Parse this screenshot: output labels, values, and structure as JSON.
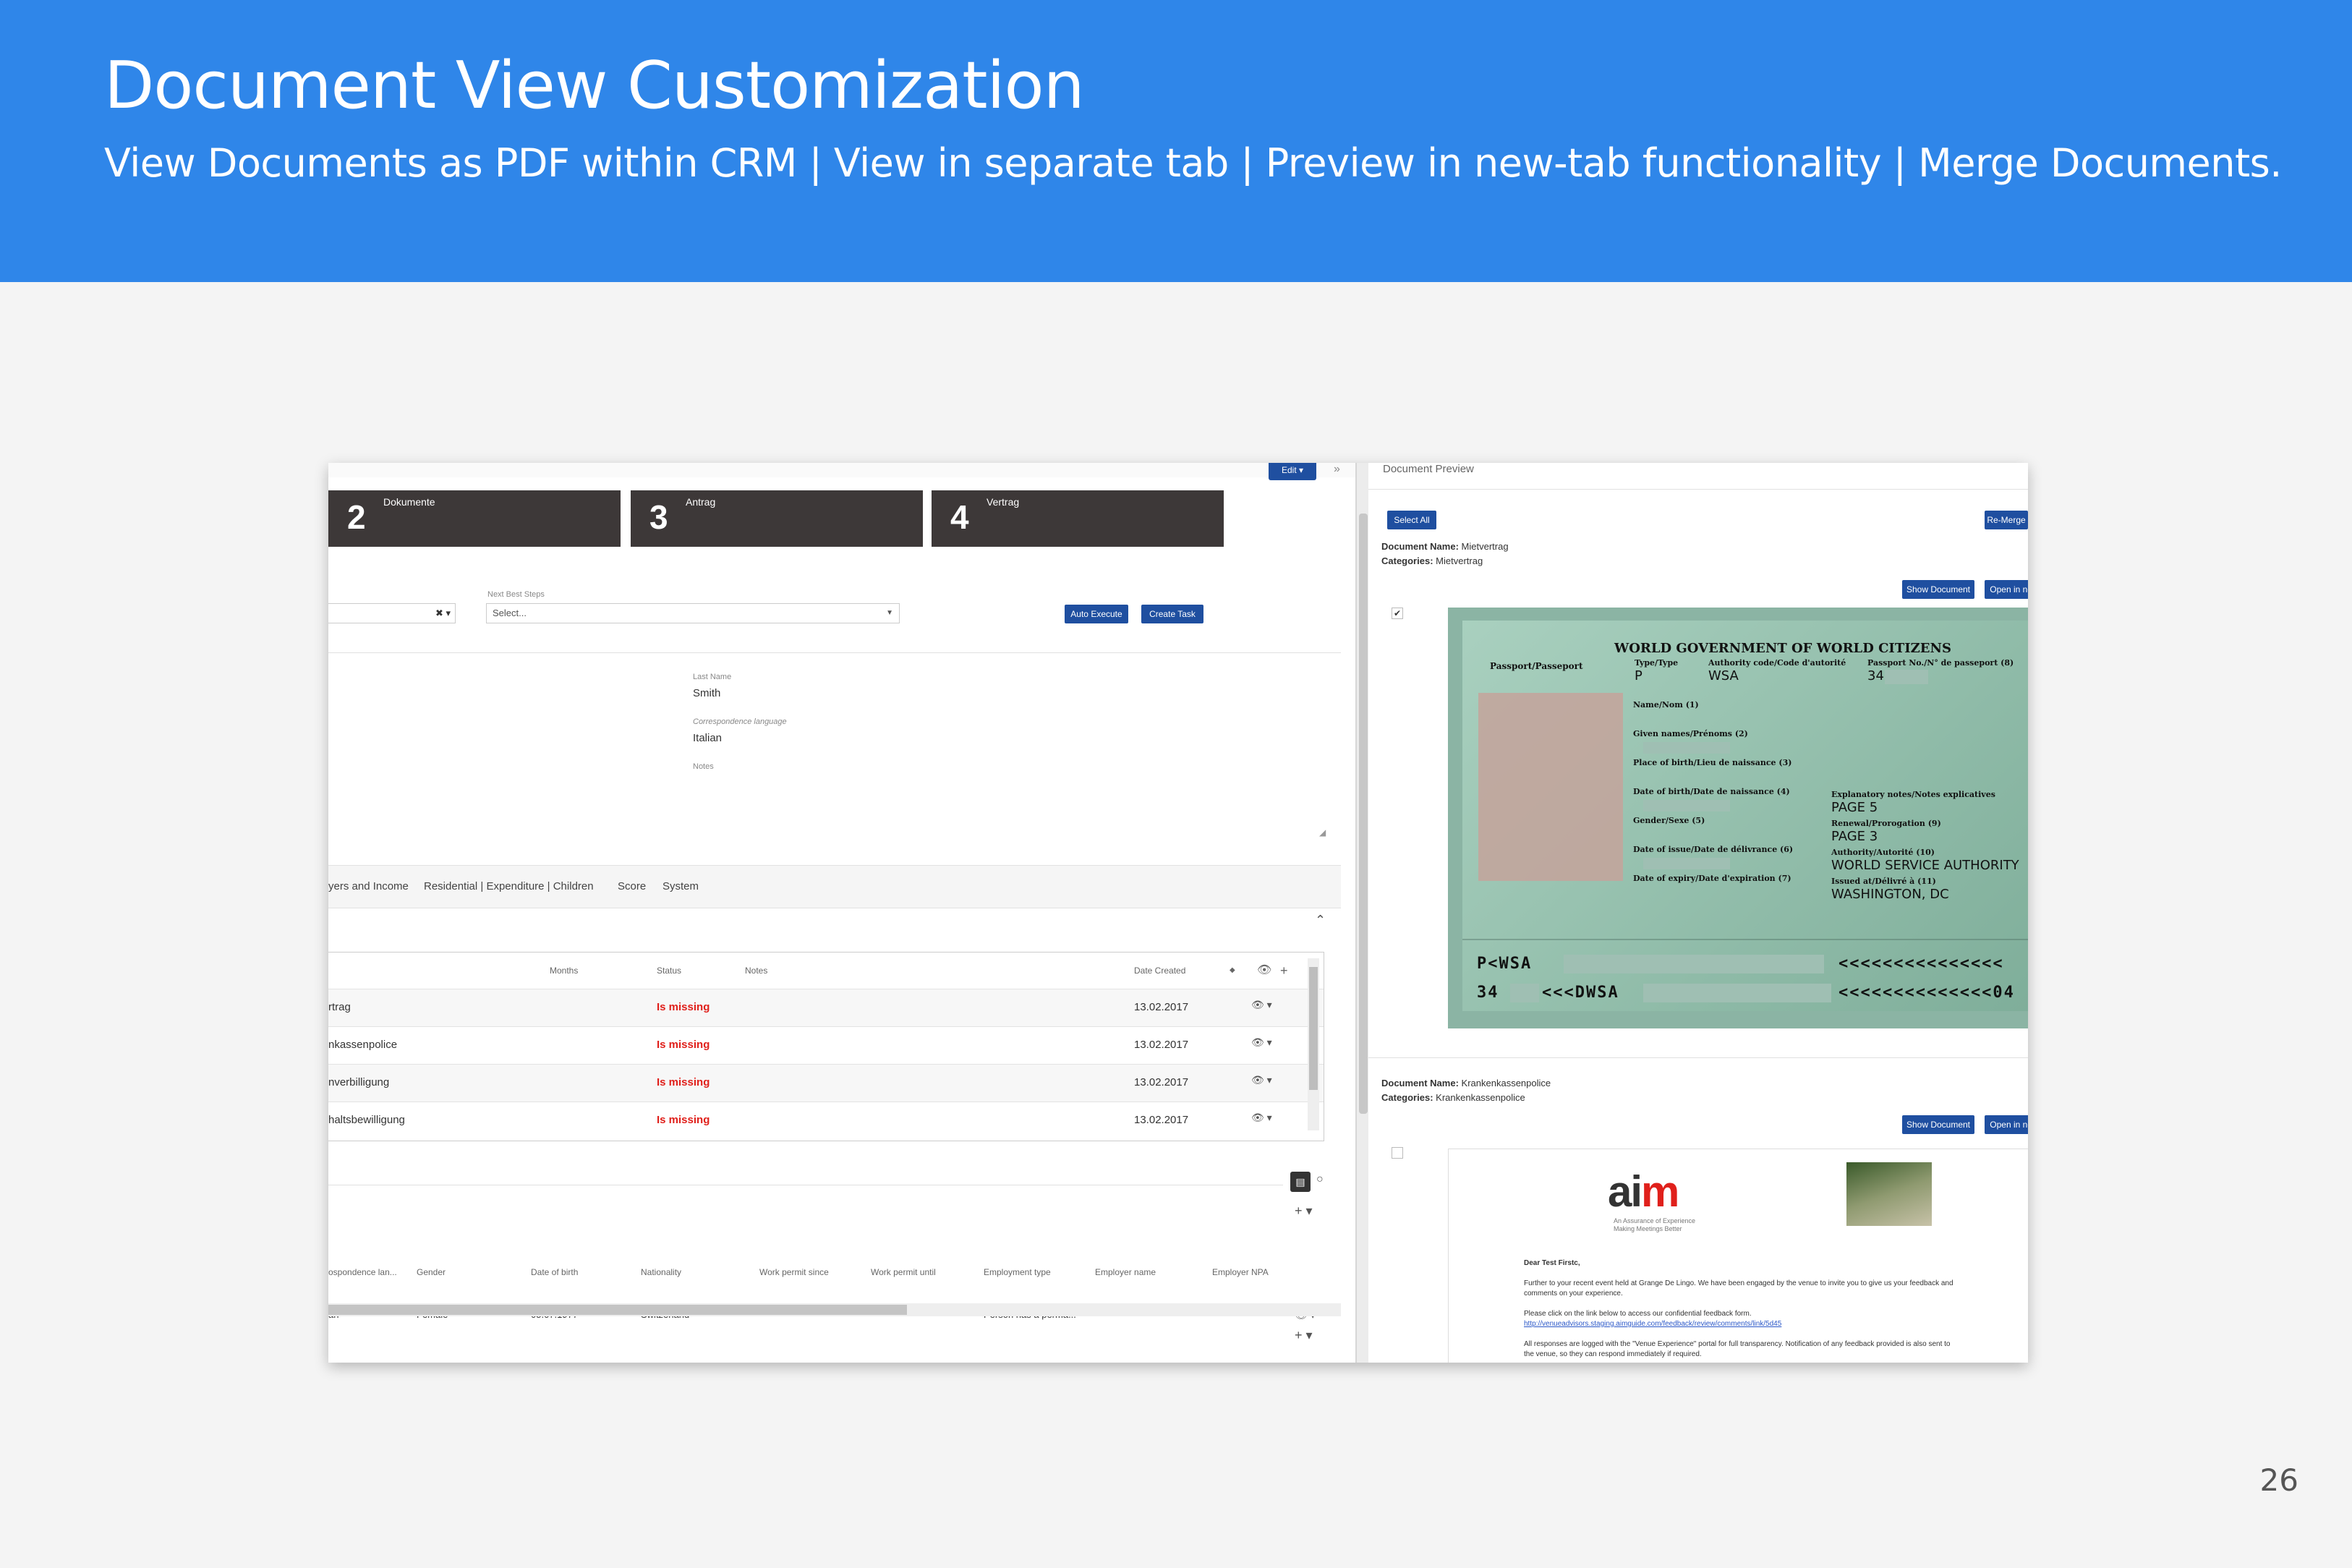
{
  "header": {
    "title": "Document View Customization",
    "subtitle": "View Documents as PDF within CRM | View in separate tab | Preview in new-tab functionality | Merge Documents."
  },
  "page_number": "26",
  "colors": {
    "banner": "#2f86e9",
    "button": "#1f4fa0",
    "missing": "#e0201b",
    "step": "#3d3838"
  },
  "crm": {
    "edit_label": "Edit",
    "steps": [
      {
        "num": "2",
        "label": "Dokumente"
      },
      {
        "num": "3",
        "label": "Antrag"
      },
      {
        "num": "4",
        "label": "Vertrag"
      }
    ],
    "next_best_steps_label": "Next Best Steps",
    "next_best_steps_placeholder": "Select...",
    "auto_execute": "Auto Execute",
    "create_task": "Create Task",
    "last_name_label": "Last Name",
    "last_name_value": "Smith",
    "language_label": "Correspondence language",
    "language_value": "Italian",
    "notes_label": "Notes",
    "tabs": [
      "yers and Income",
      "Residential | Expenditure | Children",
      "Score",
      "System"
    ],
    "table": {
      "columns": [
        "Months",
        "Status",
        "Notes",
        "Date Created"
      ],
      "rows": [
        {
          "name": "rtrag",
          "status": "Is missing",
          "date": "13.02.2017"
        },
        {
          "name": "nkassenpolice",
          "status": "Is missing",
          "date": "13.02.2017"
        },
        {
          "name": "nverbilligung",
          "status": "Is missing",
          "date": "13.02.2017"
        },
        {
          "name": "haltsbewilligung",
          "status": "Is missing",
          "date": "13.02.2017"
        }
      ]
    },
    "persons": {
      "columns": [
        "ospondence lan...",
        "Gender",
        "Date of birth",
        "Nationality",
        "Work permit since",
        "Work permit until",
        "Employment type",
        "Employer name",
        "Employer NPA"
      ],
      "row": [
        "an",
        "Female",
        "05.07.1977",
        "Switzerland",
        "",
        "",
        "Person has a perma...",
        "",
        ""
      ]
    }
  },
  "preview": {
    "title": "Document Preview",
    "select_all": "Select All",
    "re_merge": "Re-Merge",
    "doc_name_label": "Document Name:",
    "categories_label": "Categories:",
    "show_document": "Show Document",
    "open_new_tab": "Open in new tab",
    "documents": [
      {
        "name": "Mietvertrag",
        "category": "Mietvertrag"
      },
      {
        "name": "Krankenkassenpolice",
        "category": "Krankenkassenpolice"
      }
    ],
    "passport": {
      "heading": "WORLD GOVERNMENT OF WORLD CITIZENS",
      "passport_label": "Passport/Passeport",
      "type_label": "Type/Type",
      "type_value": "P",
      "authority_label": "Authority code/Code d'autorité",
      "authority_value": "WSA",
      "passport_no_label": "Passport No./N° de passeport (8)",
      "passport_no_value": "34",
      "name_label": "Name/Nom (1)",
      "given_label": "Given names/Prénoms (2)",
      "pob_label": "Place of birth/Lieu de naissance (3)",
      "dob_label": "Date of birth/Date de naissance (4)",
      "gender_label": "Gender/Sexe (5)",
      "issue_label": "Date of issue/Date de délivrance (6)",
      "expiry_label": "Date of expiry/Date d'expiration (7)",
      "explanatory_label": "Explanatory notes/Notes explicatives",
      "explanatory_value": "PAGE 5",
      "renewal_label": "Renewal/Prorogation (9)",
      "renewal_value": "PAGE 3",
      "authority2_label": "Authority/Autorité (10)",
      "authority2_value": "WORLD SERVICE AUTHORITY",
      "issued_label": "Issued at/Délivré à (11)",
      "issued_value": "WASHINGTON, DC",
      "mrz1_left": "P<WSA",
      "mrz1_right": "<<<<<<<<<<<<<<<",
      "mrz2_left": "34",
      "mrz2_mid": "<<<DWSA",
      "mrz2_right": "<<<<<<<<<<<<<<04"
    },
    "letter": {
      "logo_a": "ai",
      "logo_m": "m",
      "tagline1": "An Assurance of Experience",
      "tagline2": "Making Meetings Better",
      "greeting": "Dear Test Firstc,",
      "p1": "Further to your recent event held at Grange De Lingo. We have been engaged by the venue to invite you to give us your feedback and",
      "p1b": "comments on your experience.",
      "p2": "Please click on the link below to access our confidential feedback form.",
      "link": "http://venueadvisors.staging.aimguide.com/feedback/review/comments/link/5d45",
      "p3": "All responses are logged with the \"Venue Experience\" portal for full transparency. Notification of any feedback provided is also sent to",
      "p3b": "the venue, so they can respond immediately if required."
    }
  }
}
